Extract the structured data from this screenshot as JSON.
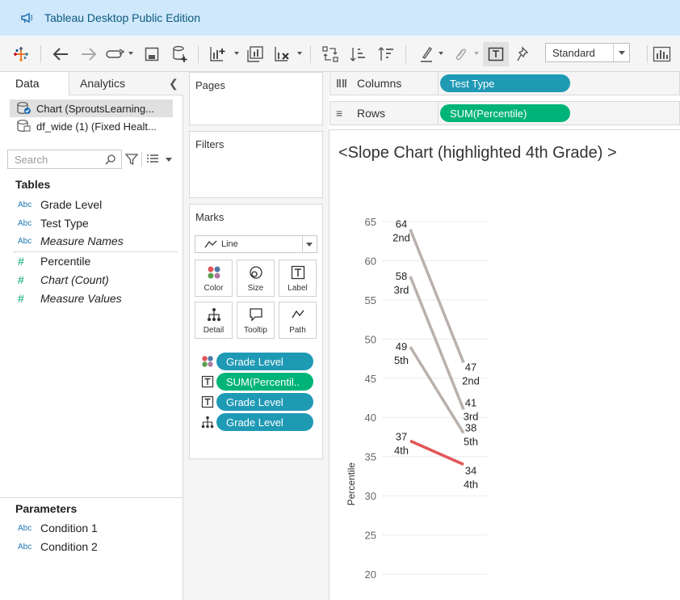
{
  "app": {
    "title": "Tableau Desktop Public Edition"
  },
  "toolbar": {
    "fit_select": "Standard"
  },
  "left_pane": {
    "tabs": {
      "data": "Data",
      "analytics": "Analytics"
    },
    "datasources": [
      {
        "label": "Chart (SproutsLearning..."
      },
      {
        "label": "df_wide (1) (Fixed Healt..."
      }
    ],
    "search_placeholder": "Search",
    "tables_title": "Tables",
    "dimensions": [
      {
        "type": "Abc",
        "name": "Grade Level"
      },
      {
        "type": "Abc",
        "name": "Test Type"
      },
      {
        "type": "Abc",
        "name": "Measure Names"
      }
    ],
    "measures": [
      {
        "type": "#",
        "name": "Percentile"
      },
      {
        "type": "#",
        "name": "Chart (Count)"
      },
      {
        "type": "#",
        "name": "Measure Values"
      }
    ],
    "parameters_title": "Parameters",
    "parameters": [
      {
        "type": "Abc",
        "name": "Condition 1"
      },
      {
        "type": "Abc",
        "name": "Condition 2"
      }
    ]
  },
  "cards": {
    "pages": "Pages",
    "filters": "Filters",
    "marks": "Marks",
    "mark_type": "Line",
    "buttons": {
      "color": "Color",
      "size": "Size",
      "label": "Label",
      "detail": "Detail",
      "tooltip": "Tooltip",
      "path": "Path"
    },
    "encodings": [
      {
        "icon": "color-icon",
        "label": "Grade Level"
      },
      {
        "icon": "label-icon",
        "label": "SUM(Percentil.."
      },
      {
        "icon": "label-icon",
        "label": "Grade Level"
      },
      {
        "icon": "detail-icon",
        "label": "Grade Level"
      }
    ]
  },
  "shelves": {
    "columns_label": "Columns",
    "columns_pill": "Test Type",
    "rows_label": "Rows",
    "rows_pill": "SUM(Percentile)"
  },
  "view": {
    "title": "<Slope Chart (highlighted 4th Grade) >"
  },
  "chart_data": {
    "type": "line",
    "title": "<Slope Chart (highlighted 4th Grade) >",
    "ylabel": "Percentile",
    "y_ticks": [
      20,
      25,
      30,
      35,
      40,
      45,
      50,
      55,
      60,
      65
    ],
    "ylim": [
      18,
      66
    ],
    "grid": true,
    "series": [
      {
        "name": "2nd",
        "values": [
          64,
          47
        ],
        "color": "#bab0ac"
      },
      {
        "name": "3rd",
        "values": [
          58,
          41
        ],
        "color": "#bab0ac"
      },
      {
        "name": "5th",
        "values": [
          49,
          38
        ],
        "color": "#bab0ac"
      },
      {
        "name": "4th",
        "values": [
          37,
          34
        ],
        "color": "#e15759"
      }
    ]
  },
  "colors": {
    "dimension_pill": "#1f9ab5",
    "measure_pill": "#00b378",
    "highlight": "#e15759",
    "muted": "#bab0ac",
    "titlebar": "#cfe8fc"
  }
}
